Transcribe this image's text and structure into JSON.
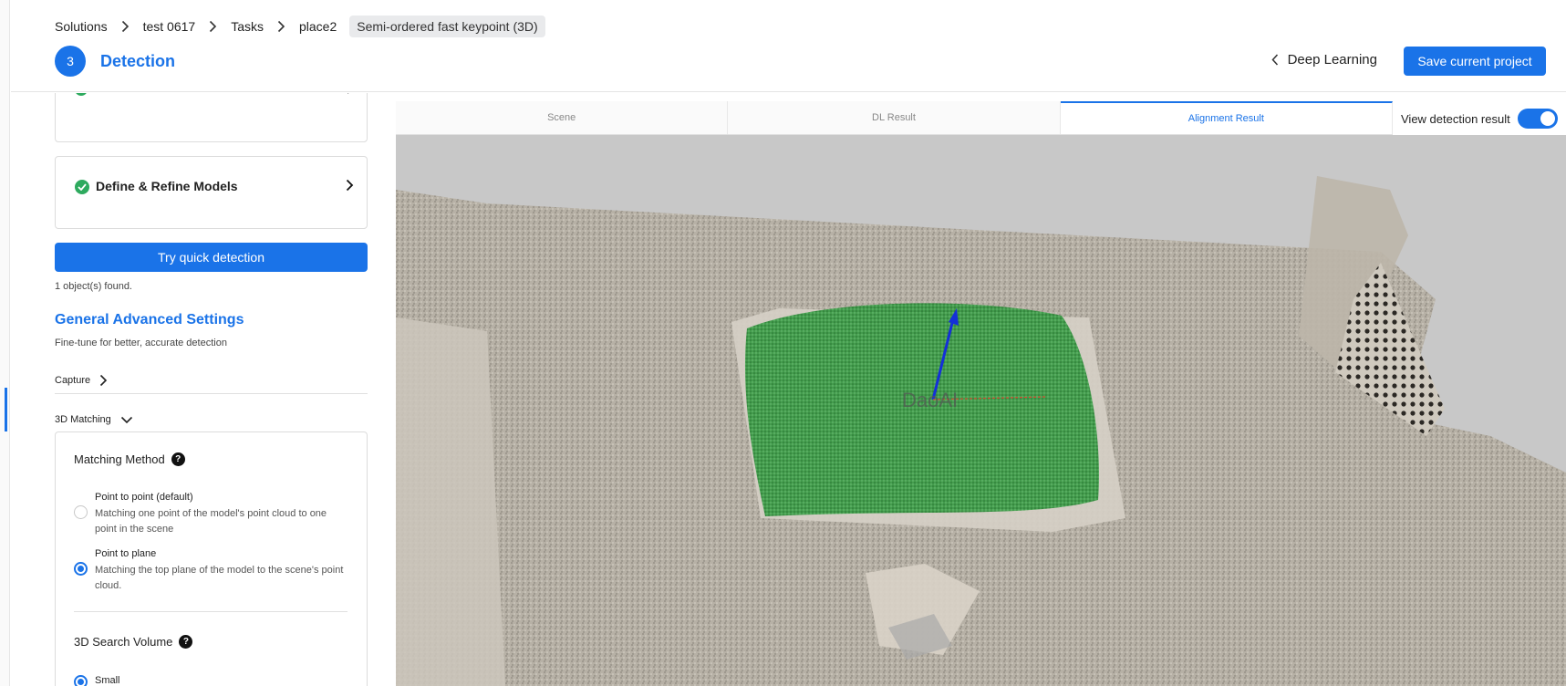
{
  "breadcrumb": {
    "items": [
      "Solutions",
      "test 0617",
      "Tasks",
      "place2"
    ],
    "current": "Semi-ordered fast keypoint (3D)"
  },
  "step": {
    "number": "3",
    "title": "Detection"
  },
  "header": {
    "back_label": "Deep Learning",
    "save_label": "Save current project"
  },
  "left_panel": {
    "models_card_label": "Define & Refine Models",
    "quick_detection_label": "Try quick detection",
    "found_text": "1 object(s) found.",
    "advanced_title": "General Advanced Settings",
    "advanced_subtitle": "Fine-tune for better, accurate detection",
    "capture_label": "Capture",
    "matching_label": "3D Matching",
    "matching_method": {
      "title": "Matching Method",
      "help": "?",
      "options": [
        {
          "label": "Point to point (default)",
          "description": "Matching one point of the model's point cloud to one point in the scene",
          "selected": false
        },
        {
          "label": "Point to plane",
          "description": "Matching the top plane of the model to the scene's point cloud.",
          "selected": true
        }
      ]
    },
    "search_volume": {
      "title": "3D Search Volume",
      "help": "?",
      "first_option_label": "Small",
      "first_option_selected": true
    }
  },
  "viewer": {
    "tabs": [
      {
        "label": "Scene",
        "active": false
      },
      {
        "label": "DL Result",
        "active": false
      },
      {
        "label": "Alignment Result",
        "active": true
      }
    ],
    "toggle_label": "View detection result",
    "toggle_on": true,
    "object_label": "DaoAI"
  },
  "colors": {
    "accent": "#1a73e8",
    "success": "#2eaa5e",
    "match_overlay": "#2e8b3a",
    "point_cloud_base": "#b9b3a8"
  }
}
